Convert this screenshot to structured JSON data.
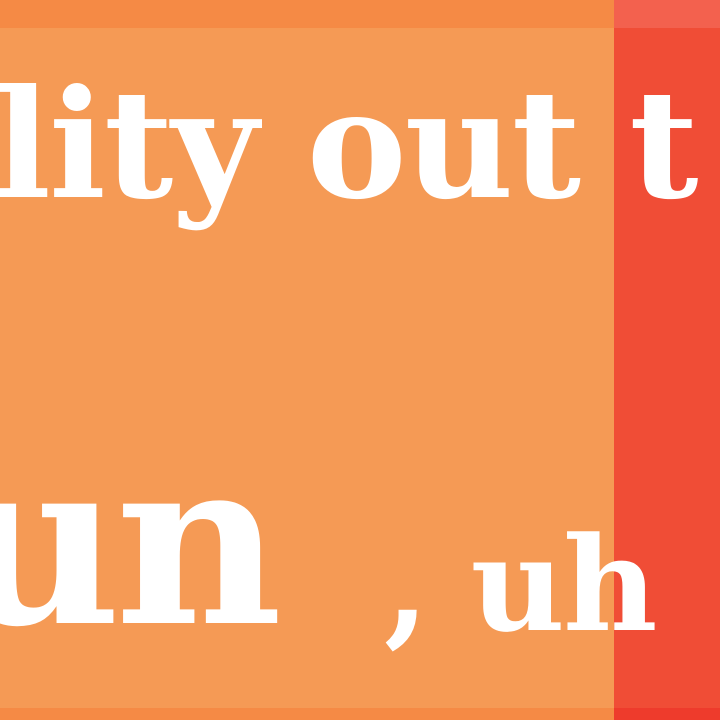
{
  "colors": {
    "left_background": "#f59a55",
    "right_background": "#f04d36",
    "top_strip": "#f58a45",
    "text": "#ffffff"
  },
  "text": {
    "line1": "lity out t",
    "line2": "un",
    "line3": ", uh"
  }
}
